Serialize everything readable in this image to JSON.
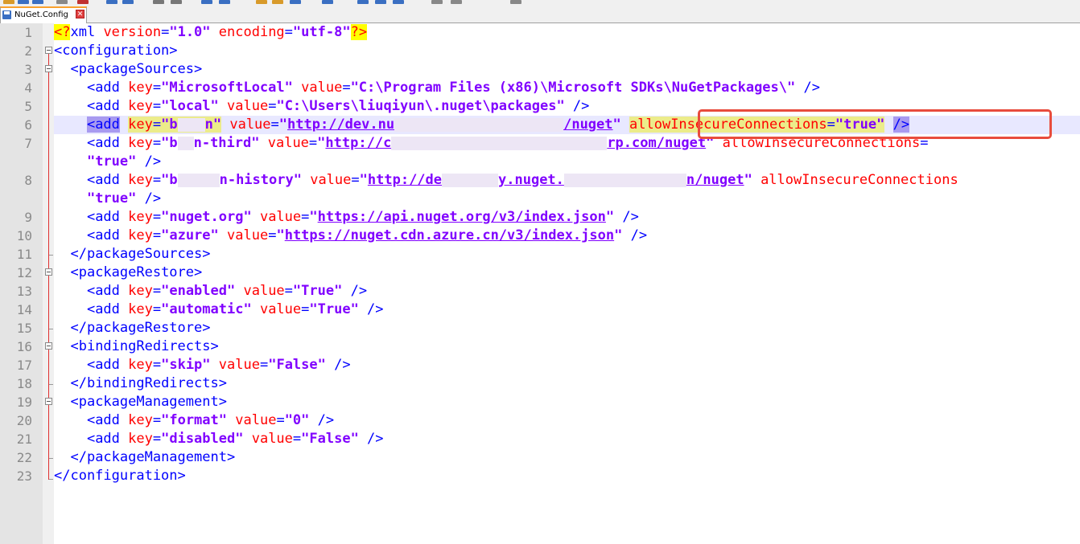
{
  "tab": {
    "filename": "NuGet.Config",
    "close_glyph": "✕"
  },
  "colors": {
    "tag": "#0000ff",
    "attribute": "#ff0000",
    "string": "#8000ff",
    "highlight_callout": "#e84c3d",
    "tab_accent": "#f9a12e"
  },
  "line_numbers": [
    "1",
    "2",
    "3",
    "4",
    "5",
    "6",
    "7",
    "",
    "8",
    "",
    "9",
    "10",
    "11",
    "12",
    "13",
    "14",
    "15",
    "16",
    "17",
    "18",
    "19",
    "20",
    "21",
    "22",
    "23"
  ],
  "code": {
    "l1": {
      "open": "<?",
      "rest": "xml ",
      "a1": "version",
      "eq1": "=",
      "s1": "\"1.0\"",
      "sp": " ",
      "a2": "encoding",
      "eq2": "=",
      "s2": "\"utf-8\"",
      "close": "?>"
    },
    "l2": {
      "text": "<configuration>"
    },
    "l3": {
      "text": "<packageSources>"
    },
    "l4": {
      "tag": "<add ",
      "a1": "key",
      "eq1": "=",
      "s1": "\"MicrosoftLocal\"",
      "sp": " ",
      "a2": "value",
      "eq2": "=",
      "s2": "\"C:\\Program Files (x86)\\Microsoft SDKs\\NuGetPackages\\\"",
      "end": " />"
    },
    "l5": {
      "tag": "<add ",
      "a1": "key",
      "eq1": "=",
      "s1": "\"local\"",
      "sp": " ",
      "a2": "value",
      "eq2": "=",
      "s2": "\"C:\\Users\\liuqiyun\\.nuget\\packages\"",
      "end": " />"
    },
    "l6": {
      "tag": "<add",
      "sp0": " ",
      "a1": "key",
      "eq1": "=",
      "s1a": "\"b",
      "s1b": "n\"",
      "sp": " ",
      "a2": "value",
      "eq2": "=",
      "q": "\"",
      "u1": "http://dev.nu",
      "u2": "/nuget",
      "q2": "\"",
      "sp2": " ",
      "a3": "allowInsecureConnections",
      "eq3": "=",
      "s3": "\"true\"",
      "sp3": " ",
      "end": "/>"
    },
    "l7": {
      "tag": "<add ",
      "a1": "key",
      "eq1": "=",
      "s1a": "\"b",
      "s1b": "n-third\"",
      "sp": " ",
      "a2": "value",
      "eq2": "=",
      "q": "\"",
      "u1": "http://c",
      "u2": "rp.com/nuget",
      "q2": "\"",
      "sp2": " ",
      "a3": "allowInsecureConnections",
      "eq3": "="
    },
    "l7b": {
      "s": "\"true\"",
      "end": " />"
    },
    "l8": {
      "tag": "<add ",
      "a1": "key",
      "eq1": "=",
      "s1a": "\"b",
      "s1b": "n-history\"",
      "sp": " ",
      "a2": "value",
      "eq2": "=",
      "q": "\"",
      "u1": "http://de",
      "u2": "y.nuget.",
      "u3": "n/nuget",
      "q2": "\"",
      "sp2": " ",
      "a3": "allowInsecureConnections"
    },
    "l8b": {
      "s": "\"true\"",
      "end": " />"
    },
    "l9": {
      "tag": "<add ",
      "a1": "key",
      "eq1": "=",
      "s1": "\"nuget.org\"",
      "sp": " ",
      "a2": "value",
      "eq2": "=",
      "q": "\"",
      "u": "https://api.nuget.org/v3/index.json",
      "q2": "\"",
      "end": " />"
    },
    "l10": {
      "tag": "<add ",
      "a1": "key",
      "eq1": "=",
      "s1": "\"azure\"",
      "sp": " ",
      "a2": "value",
      "eq2": "=",
      "q": "\"",
      "u": "https://nuget.cdn.azure.cn/v3/index.json",
      "q2": "\"",
      "end": " />"
    },
    "l11": {
      "text": "</packageSources>"
    },
    "l12": {
      "text": "<packageRestore>"
    },
    "l13": {
      "tag": "<add ",
      "a1": "key",
      "eq1": "=",
      "s1": "\"enabled\"",
      "sp": " ",
      "a2": "value",
      "eq2": "=",
      "s2": "\"True\"",
      "end": " />"
    },
    "l14": {
      "tag": "<add ",
      "a1": "key",
      "eq1": "=",
      "s1": "\"automatic\"",
      "sp": " ",
      "a2": "value",
      "eq2": "=",
      "s2": "\"True\"",
      "end": " />"
    },
    "l15": {
      "text": "</packageRestore>"
    },
    "l16": {
      "text": "<bindingRedirects>"
    },
    "l17": {
      "tag": "<add ",
      "a1": "key",
      "eq1": "=",
      "s1": "\"skip\"",
      "sp": " ",
      "a2": "value",
      "eq2": "=",
      "s2": "\"False\"",
      "end": " />"
    },
    "l18": {
      "text": "</bindingRedirects>"
    },
    "l19": {
      "text": "<packageManagement>"
    },
    "l20": {
      "tag": "<add ",
      "a1": "key",
      "eq1": "=",
      "s1": "\"format\"",
      "sp": " ",
      "a2": "value",
      "eq2": "=",
      "s2": "\"0\"",
      "end": " />"
    },
    "l21": {
      "tag": "<add ",
      "a1": "key",
      "eq1": "=",
      "s1": "\"disabled\"",
      "sp": " ",
      "a2": "value",
      "eq2": "=",
      "s2": "\"False\"",
      "end": " />"
    },
    "l22": {
      "text": "</packageManagement>"
    },
    "l23": {
      "text": "</configuration>"
    }
  }
}
